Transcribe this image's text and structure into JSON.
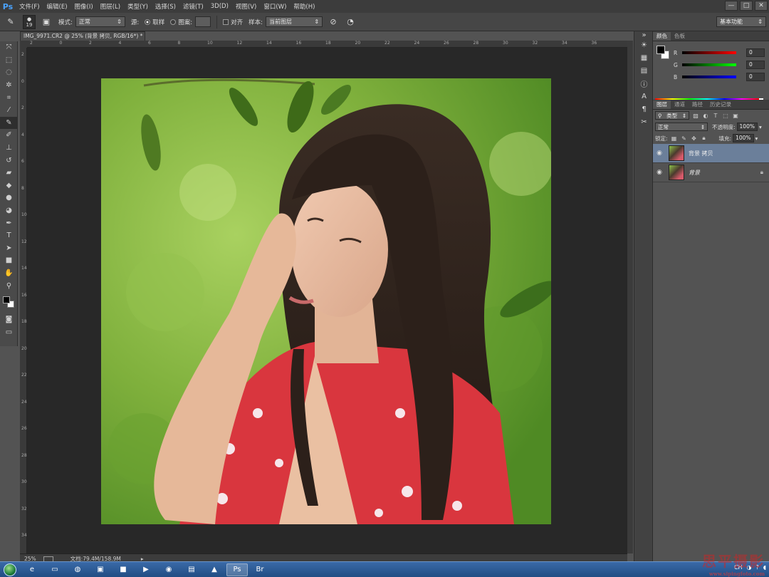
{
  "app": {
    "logo": "Ps",
    "menu": [
      "文件(F)",
      "编辑(E)",
      "图像(I)",
      "图层(L)",
      "类型(Y)",
      "选择(S)",
      "滤镜(T)",
      "3D(D)",
      "视图(V)",
      "窗口(W)",
      "帮助(H)"
    ],
    "window_controls": [
      "—",
      "□",
      "✕"
    ]
  },
  "options_bar": {
    "brush_size": "19",
    "mode_label": "模式:",
    "mode_value": "正常",
    "source_label": "源:",
    "sampled_label": "取样",
    "pattern_label": "图案:",
    "aligned_label": "对齐",
    "sample_label": "样本:",
    "sample_value": "当前图层",
    "workspace": "基本功能"
  },
  "document": {
    "tab_title": "IMG_9971.CR2 @ 25% (背景 拷贝, RGB/16*) *",
    "ruler_top": [
      "2",
      "0",
      "2",
      "4",
      "6",
      "8",
      "10",
      "12",
      "14",
      "16",
      "18",
      "20",
      "22",
      "24",
      "26",
      "28",
      "30",
      "32",
      "34",
      "36"
    ],
    "ruler_left": [
      "2",
      "0",
      "2",
      "4",
      "6",
      "8",
      "10",
      "12",
      "14",
      "16",
      "18",
      "20",
      "22",
      "24",
      "26",
      "28",
      "30",
      "32",
      "34"
    ],
    "zoom": "25%",
    "doc_info": "文档:79.4M/158.9M"
  },
  "panels": {
    "color_tabs": [
      "颜色",
      "色板"
    ],
    "rgb": [
      {
        "ch": "R",
        "value": "0"
      },
      {
        "ch": "G",
        "value": "0"
      },
      {
        "ch": "B",
        "value": "0"
      }
    ],
    "layer_tabs": [
      "图层",
      "通道",
      "路径",
      "历史记录"
    ],
    "filter_kind": "类型",
    "blend_mode": "正常",
    "opacity_label": "不透明度:",
    "opacity": "100%",
    "lock_label": "锁定:",
    "fill_label": "填充:",
    "fill": "100%",
    "layers": [
      {
        "name": "背景 拷贝",
        "selected": true,
        "locked": false
      },
      {
        "name": "背景",
        "selected": false,
        "locked": true
      }
    ]
  },
  "taskbar": {
    "tray_lang": "CH",
    "watermark": "思平摄影",
    "watermark_url": "www.sipingfoto.com"
  },
  "colors": {
    "accent": "#4aa3ff",
    "selected_layer": "#6b7f9a",
    "taskbar": "#2a5a96"
  }
}
